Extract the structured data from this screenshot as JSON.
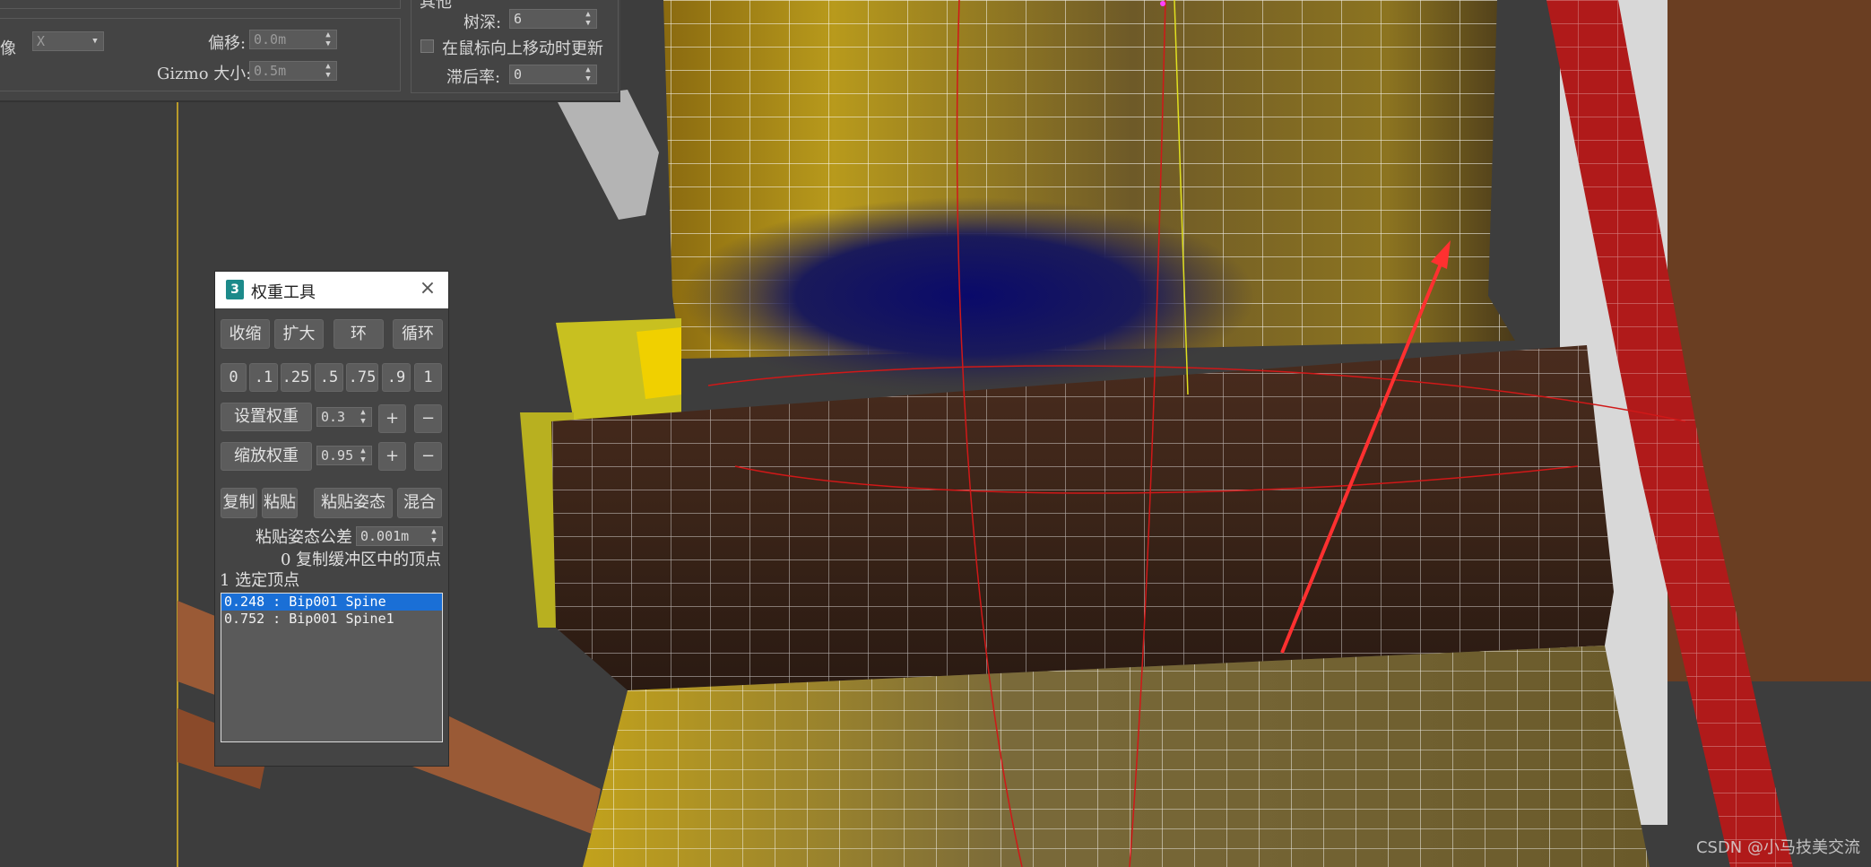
{
  "top_panel": {
    "mirror_label": "像",
    "mirror_axis_value": "X",
    "offset_label": "偏移:",
    "offset_value": "0.0m",
    "gizmo_size_label": "Gizmo 大小:",
    "gizmo_size_value": "0.5m",
    "group_title_fragment": "其他",
    "tree_depth_label": "树深:",
    "tree_depth_value": "6",
    "update_on_mouse_up_label": "在鼠标向上移动时更新",
    "update_on_mouse_up_checked": false,
    "lag_rate_label": "滞后率:",
    "lag_rate_value": "0"
  },
  "weight_tool": {
    "title": "权重工具",
    "icon_glyph": "3",
    "close_glyph": "×",
    "select_buttons": [
      "收缩",
      "扩大",
      "环",
      "循环"
    ],
    "weight_presets": [
      "0",
      ".1",
      ".25",
      ".5",
      ".75",
      ".9",
      "1"
    ],
    "set_weight_label": "设置权重",
    "set_weight_value": "0.3",
    "scale_weight_label": "缩放权重",
    "scale_weight_value": "0.95",
    "plus": "+",
    "minus": "−",
    "copy_label": "复制",
    "paste_label": "粘贴",
    "paste_pose_label": "粘贴姿态",
    "blend_label": "混合",
    "paste_pose_tolerance_label": "粘贴姿态公差",
    "paste_pose_tolerance_value": "0.001m",
    "buffer_vertices_text": "0 复制缓冲区中的顶点",
    "selected_vertices_text": "1 选定顶点",
    "bone_weights": [
      {
        "text": "0.248 : Bip001 Spine",
        "selected": true
      },
      {
        "text": "0.752 : Bip001 Spine1",
        "selected": false
      }
    ]
  },
  "watermark": "CSDN @小马技美交流"
}
